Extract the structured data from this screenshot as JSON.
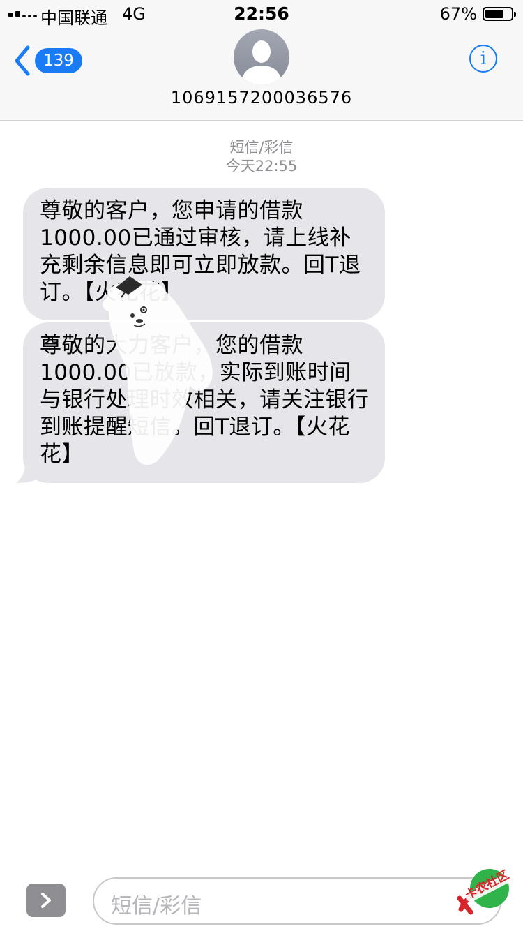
{
  "status_bar": {
    "carrier": "中国联通",
    "network": "4G",
    "time": "22:56",
    "battery_percent": "67%"
  },
  "nav": {
    "back_count": "139",
    "contact_number": "1069157200036576",
    "info_label": "i"
  },
  "thread": {
    "type_label": "短信/彩信",
    "timestamp": "今天22:55",
    "messages": [
      {
        "text": "尊敬的客户，您申请的借款1000.00已通过审核，请上线补充剩余信息即可立即放款。回T退订。【火花花】"
      },
      {
        "text": "尊敬的大力客户，您的借款1000.00已放款，实际到账时间与银行处理时效相关，请关注银行到账提醒短信。回T退订。【火花花】"
      }
    ]
  },
  "composer": {
    "placeholder": "短信/彩信"
  },
  "watermark": {
    "logo_text": "卡农社区"
  },
  "colors": {
    "accent": "#1a7cf5",
    "bubble_incoming": "#e5e5ea",
    "header_bg": "#f7f7f7",
    "secondary_text": "#8e8e93",
    "logo_green": "#2fb34a",
    "logo_red": "#d6262c"
  },
  "icons": {
    "back": "chevron-left-icon",
    "info": "info-circle-icon",
    "avatar": "person-silhouette-icon",
    "apps": "chevron-right-icon"
  }
}
